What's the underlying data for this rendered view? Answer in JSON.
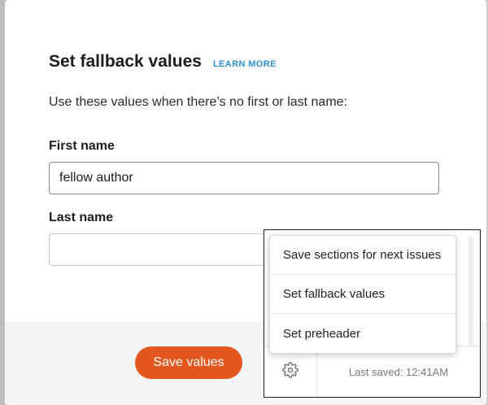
{
  "dialog": {
    "title": "Set fallback values",
    "learn_more": "LEARN MORE",
    "description": "Use these values when there’s no first or last name:",
    "first_name": {
      "label": "First name",
      "value": "fellow author",
      "placeholder": ""
    },
    "last_name": {
      "label": "Last name",
      "value": "",
      "placeholder": ""
    },
    "save_label": "Save values"
  },
  "menu": {
    "items": [
      {
        "label": "Save sections for next issues"
      },
      {
        "label": "Set fallback values"
      },
      {
        "label": "Set preheader"
      }
    ]
  },
  "panel_footer": {
    "settings_icon": "gear-icon",
    "last_saved": "Last saved: 12:41AM"
  },
  "colors": {
    "accent": "#e3571e",
    "link": "#2d8fd5",
    "footer_bg": "#f4f5f7"
  }
}
